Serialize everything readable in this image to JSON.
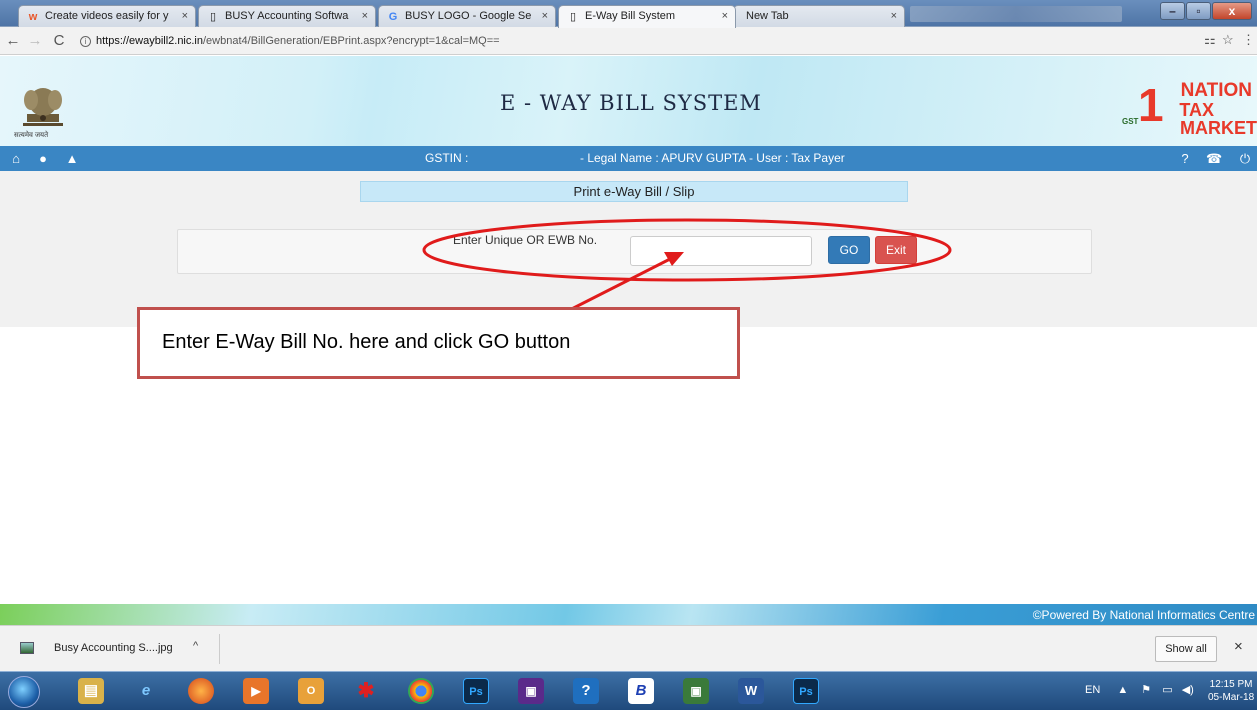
{
  "browser": {
    "tabs": [
      {
        "label": "Create videos easily for y",
        "icon": "wevideo-icon"
      },
      {
        "label": "BUSY Accounting Softwa",
        "icon": "page-icon"
      },
      {
        "label": "BUSY LOGO - Google Se",
        "icon": "google-icon"
      },
      {
        "label": "E-Way Bill System",
        "icon": "page-icon"
      },
      {
        "label": "New Tab",
        "icon": ""
      }
    ],
    "close_glyph": "×",
    "url_host": "https://ewaybill2.nic.in",
    "url_path": "/ewbnat4/BillGeneration/EBPrint.aspx?encrypt=1&cal=MQ=="
  },
  "site": {
    "title": "E - WAY BILL SYSTEM",
    "emblem_caption": "सत्यमेव जयते",
    "nation_logo": {
      "one": "1",
      "line1": "NATION",
      "line2": "TAX",
      "line3": "MARKET",
      "gst": "GST"
    },
    "gstin_label": "GSTIN :",
    "legal_text": "- Legal Name : APURV GUPTA - User : Tax Payer"
  },
  "form": {
    "page_title": "Print e-Way Bill / Slip",
    "field_label": "Enter Unique OR EWB No.",
    "field_value": "",
    "go_label": "GO",
    "exit_label": "Exit"
  },
  "annotation": {
    "callout_text": "Enter E-Way Bill No. here and click GO button",
    "color": "#e01b1b"
  },
  "footer": {
    "powered_by": "©Powered By National Informatics Centre"
  },
  "downloads": {
    "file_name": "Busy Accounting S....jpg",
    "show_all": "Show all"
  },
  "taskbar": {
    "lang": "EN",
    "time": "12:15 PM",
    "date": "05-Mar-18"
  }
}
